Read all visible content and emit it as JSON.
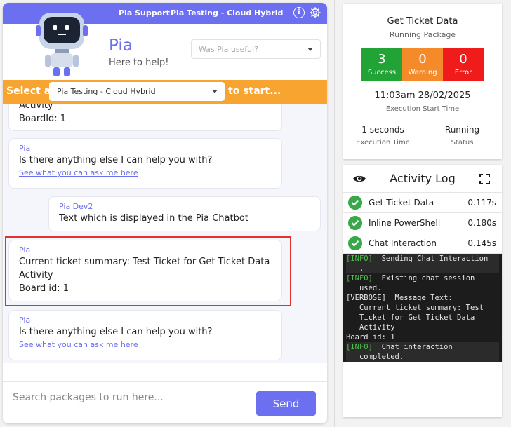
{
  "header": {
    "title": "Pia Support",
    "environment": "Pia Testing - Cloud Hybrid",
    "info_icon": "info-icon",
    "settings_icon": "gear-icon"
  },
  "hero": {
    "name": "Pia",
    "tagline": "Here to help!",
    "feedback_placeholder": "Was Pia useful?"
  },
  "selector": {
    "prefix": "Select a",
    "selected": "Pia Testing - Cloud Hybrid",
    "suffix": "to start..."
  },
  "messages": [
    {
      "sender": "",
      "lines": [
        "Activity",
        "BoardId: 1"
      ],
      "link": ""
    },
    {
      "sender": "Pia",
      "lines": [
        "Is there anything else I can help you with?"
      ],
      "link": "See what you can ask me here"
    },
    {
      "sender": "Pia Dev2",
      "lines": [
        "Text which is displayed in the Pia Chatbot"
      ],
      "link": ""
    },
    {
      "sender": "Pia",
      "lines": [
        "Current ticket summary: Test Ticket for Get Ticket Data Activity",
        "Board id: 1"
      ],
      "link": ""
    },
    {
      "sender": "Pia",
      "lines": [
        "Is there anything else I can help you with?"
      ],
      "link": "See what you can ask me here"
    }
  ],
  "input": {
    "placeholder": "Search packages to run here...",
    "send_label": "Send"
  },
  "ticket": {
    "title": "Get Ticket Data",
    "subtitle": "Running Package",
    "success_count": "3",
    "success_label": "Success",
    "warning_count": "0",
    "warning_label": "Warning",
    "error_count": "0",
    "error_label": "Error",
    "start_time": "11:03am 28/02/2025",
    "start_label": "Execution Start Time",
    "exec_time": "1 seconds",
    "exec_label": "Execution Time",
    "status": "Running",
    "status_label": "Status",
    "colors": {
      "success": "#21a335",
      "warning": "#f58a2a",
      "error": "#f01c1c"
    }
  },
  "activity_log": {
    "title": "Activity Log",
    "rows": [
      {
        "name": "Get Ticket Data",
        "time": "0.117s"
      },
      {
        "name": "Inline PowerShell",
        "time": "0.180s"
      },
      {
        "name": "Chat Interaction",
        "time": "0.145s"
      }
    ],
    "console": [
      {
        "tag": "[INFO]",
        "text": "  Sending Chat Interaction\n   .",
        "highlight": true
      },
      {
        "tag": "[INFO]",
        "text": "  Existing chat session\n   used.",
        "highlight": false
      },
      {
        "tag": "[VERBOSE]",
        "text": "  Message Text:\n   Current ticket summary: Test\n   Ticket for Get Ticket Data\n   Activity\nBoard id: 1",
        "highlight": false
      },
      {
        "tag": "[INFO]",
        "text": "  Chat interaction\n   completed.",
        "highlight": true
      }
    ]
  },
  "accent_color": "#6b6ff0",
  "orange_color": "#f7a431"
}
